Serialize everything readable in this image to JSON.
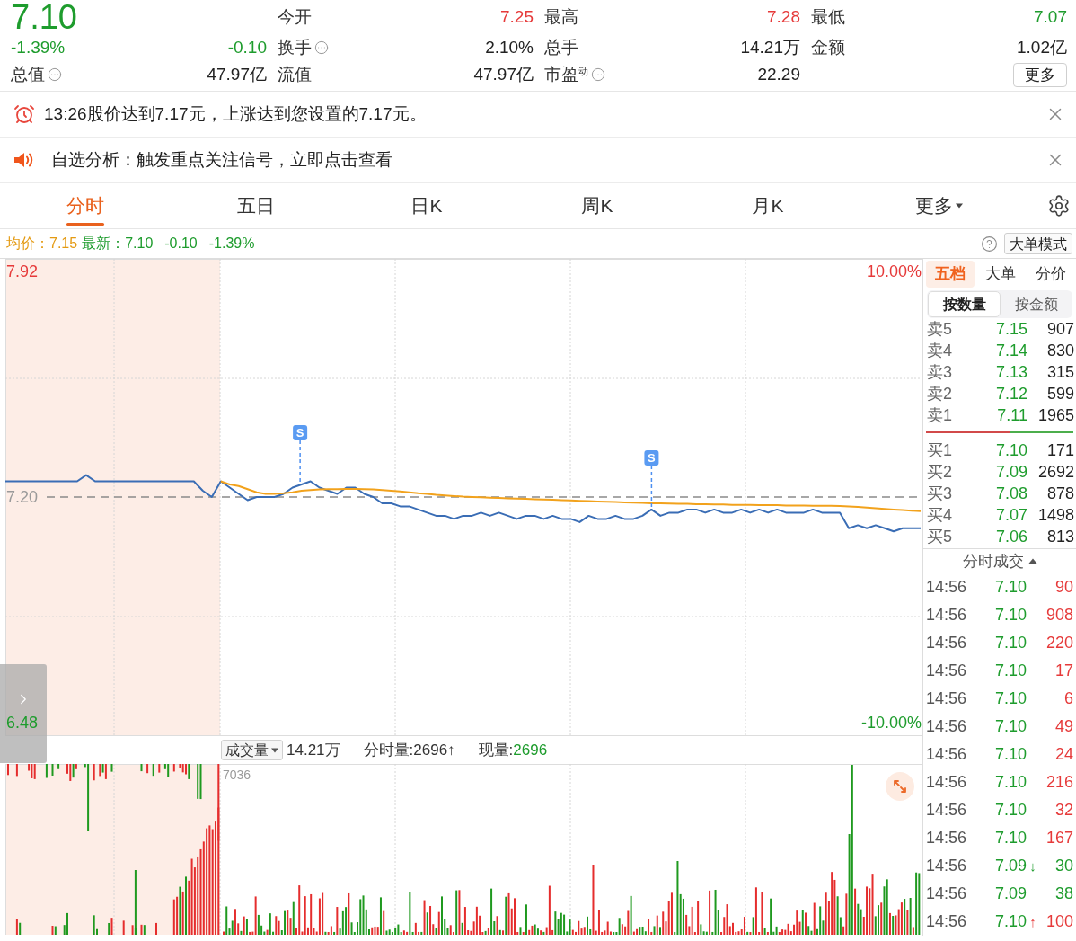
{
  "quote": {
    "price": "7.10",
    "change_pct": "-1.39%",
    "change": "-0.10",
    "rising": false
  },
  "stats": [
    {
      "label": "今开",
      "value": "7.25",
      "color": "#e63a3a",
      "info": false
    },
    {
      "label": "最高",
      "value": "7.28",
      "color": "#e63a3a",
      "info": false
    },
    {
      "label": "最低",
      "value": "7.07",
      "color": "#1e9c2d",
      "info": false
    },
    {
      "label": "换手",
      "value": "2.10%",
      "color": "#222222",
      "info": true
    },
    {
      "label": "总手",
      "value": "14.21万",
      "color": "#222222",
      "info": false
    },
    {
      "label": "金额",
      "value": "1.02亿",
      "color": "#222222",
      "info": false
    },
    {
      "label": "总值",
      "value": "47.97亿",
      "color": "#222222",
      "info": true
    },
    {
      "label": "流值",
      "value": "47.97亿",
      "color": "#222222",
      "info": false
    },
    {
      "label": "市盈$^{动}$",
      "value": "22.29",
      "color": "#222222",
      "info": true
    }
  ],
  "more_button": "更多",
  "alerts": [
    {
      "kind": "price_alert",
      "text": "13:26股价达到7.17元，上涨达到您设置的7.17元。"
    },
    {
      "kind": "signal",
      "text": "自选分析：触发重点关注信号，立即点击查看"
    }
  ],
  "tabs": [
    {
      "label": "分时",
      "selected": true,
      "dropdown": false
    },
    {
      "label": "五日",
      "selected": false,
      "dropdown": false
    },
    {
      "label": "日K",
      "selected": false,
      "dropdown": false
    },
    {
      "label": "周K",
      "selected": false,
      "dropdown": false
    },
    {
      "label": "月K",
      "selected": false,
      "dropdown": false
    },
    {
      "label": "更多",
      "selected": false,
      "dropdown": true
    }
  ],
  "summary": {
    "average": "均价：7.15",
    "latest": "最新：7.10",
    "change": "-0.10",
    "change_pct": "-1.39%"
  },
  "mode_button": "大单模式",
  "price_chart": {
    "right_labels": [
      "10.00%",
      "-10.00%"
    ],
    "chart_data": {
      "type": "line",
      "ylim": [
        6.437,
        7.96
      ],
      "yticks": [
        {
          "value": 7.92,
          "label": "7.92"
        },
        {
          "value": 7.2,
          "label": "7.20"
        },
        {
          "value": 6.48,
          "label": "6.48"
        }
      ],
      "ref_lines": [
        {
          "axis": "y",
          "value": 7.2
        }
      ],
      "series": [
        {
          "color": "#3a6db5",
          "values": [
            7.25,
            7.25,
            7.25,
            7.25,
            7.25,
            7.25,
            7.25,
            7.25,
            7.25,
            7.27,
            7.25,
            7.25,
            7.25,
            7.25,
            7.25,
            7.25,
            7.25,
            7.25,
            7.25,
            7.25,
            7.25,
            7.25,
            7.22,
            7.2,
            7.25,
            7.23,
            7.21,
            7.19,
            7.2,
            7.2,
            7.2,
            7.21,
            7.23,
            7.24,
            7.25,
            7.23,
            7.22,
            7.21,
            7.23,
            7.23,
            7.21,
            7.2,
            7.18,
            7.18,
            7.17,
            7.17,
            7.16,
            7.15,
            7.14,
            7.14,
            7.13,
            7.14,
            7.14,
            7.15,
            7.14,
            7.15,
            7.14,
            7.13,
            7.14,
            7.14,
            7.13,
            7.14,
            7.13,
            7.13,
            7.12,
            7.14,
            7.13,
            7.13,
            7.14,
            7.13,
            7.13,
            7.14,
            7.16,
            7.14,
            7.15,
            7.15,
            7.16,
            7.16,
            7.15,
            7.16,
            7.15,
            7.15,
            7.16,
            7.15,
            7.16,
            7.15,
            7.16,
            7.15,
            7.15,
            7.15,
            7.16,
            7.15,
            7.15,
            7.15,
            7.1,
            7.11,
            7.1,
            7.11,
            7.1,
            7.09,
            7.1,
            7.1,
            7.1
          ]
        },
        {
          "color": "#f2a21c",
          "values": [
            null,
            null,
            null,
            null,
            null,
            null,
            null,
            null,
            null,
            null,
            null,
            null,
            null,
            null,
            null,
            null,
            null,
            null,
            null,
            null,
            null,
            null,
            null,
            null,
            7.25,
            7.24,
            7.235,
            7.225,
            7.215,
            7.21,
            7.21,
            7.212,
            7.215,
            7.22,
            7.222,
            7.224,
            7.225,
            7.225,
            7.226,
            7.226,
            7.225,
            7.224,
            7.222,
            7.22,
            7.218,
            7.215,
            7.212,
            7.21,
            7.207,
            7.205,
            7.203,
            7.201,
            7.2,
            7.199,
            7.198,
            7.197,
            7.196,
            7.195,
            7.194,
            7.193,
            7.192,
            7.191,
            7.19,
            7.189,
            7.188,
            7.187,
            7.186,
            7.185,
            7.184,
            7.183,
            7.182,
            7.181,
            7.18,
            7.18,
            7.179,
            7.178,
            7.178,
            7.177,
            7.177,
            7.176,
            7.176,
            7.175,
            7.175,
            7.175,
            7.174,
            7.174,
            7.174,
            7.173,
            7.173,
            7.173,
            7.172,
            7.172,
            7.172,
            7.171,
            7.17,
            7.168,
            7.166,
            7.164,
            7.162,
            7.16,
            7.158,
            7.156,
            7.155
          ]
        }
      ],
      "annotations": [
        "S",
        "S"
      ]
    }
  },
  "volume": {
    "selector": "成交量",
    "total": "14.21万",
    "minute_volume": "分时量:2696↑",
    "current_label": "现量:",
    "current": "2696",
    "max_label": "7036"
  },
  "order_panel": {
    "tabs": [
      {
        "label": "五档",
        "selected": true
      },
      {
        "label": "大单",
        "selected": false
      },
      {
        "label": "分价",
        "selected": false
      }
    ],
    "modes": [
      {
        "label": "按数量",
        "selected": true
      },
      {
        "label": "按金额",
        "selected": false
      }
    ],
    "asks": [
      {
        "label": "卖5",
        "price": "7.15",
        "volume": "907"
      },
      {
        "label": "卖4",
        "price": "7.14",
        "volume": "830"
      },
      {
        "label": "卖3",
        "price": "7.13",
        "volume": "315"
      },
      {
        "label": "卖2",
        "price": "7.12",
        "volume": "599"
      },
      {
        "label": "卖1",
        "price": "7.11",
        "volume": "1965"
      }
    ],
    "balance": {
      "level": 0.57
    },
    "bids": [
      {
        "label": "买1",
        "price": "7.10",
        "volume": "171"
      },
      {
        "label": "买2",
        "price": "7.09",
        "volume": "2692"
      },
      {
        "label": "买3",
        "price": "7.08",
        "volume": "878"
      },
      {
        "label": "买4",
        "price": "7.07",
        "volume": "1498"
      },
      {
        "label": "买5",
        "price": "7.06",
        "volume": "813"
      }
    ]
  },
  "trades": {
    "title": "分时成交",
    "rows": [
      {
        "time": "14:56",
        "price": "7.10",
        "volume": "90",
        "color": "#e63a3a"
      },
      {
        "time": "14:56",
        "price": "7.10",
        "volume": "908",
        "color": "#e63a3a"
      },
      {
        "time": "14:56",
        "price": "7.10",
        "volume": "220",
        "color": "#e63a3a"
      },
      {
        "time": "14:56",
        "price": "7.10",
        "volume": "17",
        "color": "#e63a3a"
      },
      {
        "time": "14:56",
        "price": "7.10",
        "volume": "6",
        "color": "#e63a3a"
      },
      {
        "time": "14:56",
        "price": "7.10",
        "volume": "49",
        "color": "#e63a3a"
      },
      {
        "time": "14:56",
        "price": "7.10",
        "volume": "24",
        "color": "#e63a3a"
      },
      {
        "time": "14:56",
        "price": "7.10",
        "volume": "216",
        "color": "#e63a3a"
      },
      {
        "time": "14:56",
        "price": "7.10",
        "volume": "32",
        "color": "#e63a3a"
      },
      {
        "time": "14:56",
        "price": "7.10",
        "volume": "167",
        "color": "#e63a3a"
      },
      {
        "time": "14:56",
        "price": "7.09",
        "arrow": "↓",
        "volume": "30",
        "color": "#1e9c2d"
      },
      {
        "time": "14:56",
        "price": "7.09",
        "volume": "38",
        "color": "#1e9c2d"
      },
      {
        "time": "14:56",
        "price": "7.10",
        "arrow": "↑",
        "volume": "100",
        "color": "#e63a3a"
      }
    ]
  }
}
